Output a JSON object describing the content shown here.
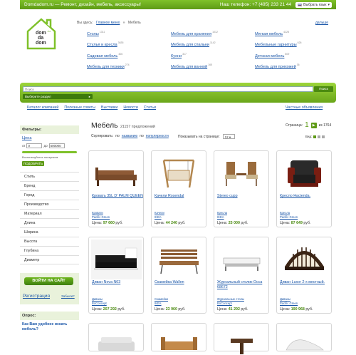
{
  "header": {
    "site_text": "Domdadom.ru — Ремонт, дизайн, мебель, аксессуары!",
    "phone": "Наш телефон: +7 (495) 233 21 44",
    "lang_button": "Выбрать язык"
  },
  "logo": {
    "line1": "dom",
    "line2": "da",
    "line3": "dom",
    "tld": ".ru"
  },
  "breadcrumb": {
    "prefix": "Вы здесь:",
    "home": "Главное меню",
    "sep": "»",
    "current": "Мебель"
  },
  "further_link": "дальше",
  "categories": [
    {
      "label": "Столы",
      "count": "1311"
    },
    {
      "label": "Мебель для хранения",
      "count": "1012"
    },
    {
      "label": "Мягкая мебель",
      "count": "4228"
    },
    {
      "label": "Стулья и кресла",
      "count": "3635"
    },
    {
      "label": "Мебель для спальни",
      "count": "1142"
    },
    {
      "label": "Мебельные гарнитуры",
      "count": "626"
    },
    {
      "label": "Садовая мебель",
      "count": "406"
    },
    {
      "label": "Кухни",
      "count": "317"
    },
    {
      "label": "Детская мебель",
      "count": "809"
    },
    {
      "label": "Мебель для техники",
      "count": "274"
    },
    {
      "label": "Мебель для ванной",
      "count": "165"
    },
    {
      "label": "Мебель для прихожей",
      "count": "36"
    }
  ],
  "search": {
    "placeholder": "Поиск",
    "button": "Поиск",
    "section_select": "Выберите раздел"
  },
  "menu": [
    "Каталог компаний",
    "Полезные советы",
    "Выставки",
    "Новости",
    "Статьи"
  ],
  "ads_link": "Частные объявления",
  "filters": {
    "title": "Фильтры:",
    "price_label": "Цена",
    "from_label": "от",
    "from_value": "0",
    "to_label": "до",
    "to_value": "500000",
    "hint": "Воспользуйтесь ползунком",
    "apply": "ПОДОБРАТЬ",
    "facets": [
      "Стиль",
      "Бренд",
      "Город",
      "Производство",
      "Материал",
      "Длина",
      "Ширина",
      "Высота",
      "Глубина",
      "Диаметр"
    ]
  },
  "login": {
    "button": "ВОЙТИ НА САЙТ",
    "register": "Регистрация",
    "forgot": "Забыли?"
  },
  "poll": {
    "title": "Опрос:",
    "question": "Как Вам удобнее искать мебель?"
  },
  "main": {
    "title": "Мебель",
    "count": "21157 предложений",
    "sort_label": "Сортировать:",
    "sort_by_name_prefix": "по",
    "sort_by_name": "названию",
    "sort_by_pop_prefix": "по",
    "sort_by_pop": "популярности",
    "per_page_label": "Показывать на странице:",
    "per_page_value": "12",
    "page_label": "Страница:",
    "page_current": "1",
    "page_total": "из 1764",
    "view_label": "Вид:"
  },
  "products": [
    {
      "title": "Кровать 35L D' PALM QUEEN",
      "cat1": "Кровати",
      "cat2": "Pacific Green",
      "price_label": "Цена:",
      "price": "97 660",
      "currency": "руб."
    },
    {
      "title": "Качели Rosendal",
      "cat1": "Качели",
      "cat2": "IKEA",
      "price_label": "Цена:",
      "price": "44 240",
      "currency": "руб."
    },
    {
      "title": "Stereo cupp",
      "cat1": "Кресла",
      "cat2": "IKEA",
      "price_label": "Цена:",
      "price": "25 000",
      "currency": "руб."
    },
    {
      "title": "Кресло Hacienda.",
      "cat1": "Кресла",
      "cat2": "Pacific Green",
      "price_label": "Цена:",
      "price": "87 649",
      "currency": "руб."
    },
    {
      "title": "Диван Nova N03",
      "cat1": "Диваны",
      "cat2": "BoConcept",
      "price_label": "Цена:",
      "price": "207 292",
      "currency": "руб."
    },
    {
      "title": "Скамейка Wallen",
      "cat1": "Скамейки",
      "cat2": "IKEA",
      "price_label": "Цена:",
      "price": "23 960",
      "currency": "руб."
    },
    {
      "title": "Журнальный столик Occa 68672",
      "cat1": "Журнальные столы",
      "cat2": "BoConcept",
      "price_label": "Цена:",
      "price": "41 292",
      "currency": "руб."
    },
    {
      "title": "Диван Luxor 2-х местный.",
      "cat1": "Диваны",
      "cat2": "Pacific Green",
      "price_label": "Цена:",
      "price": "190 968",
      "currency": "руб."
    }
  ]
}
